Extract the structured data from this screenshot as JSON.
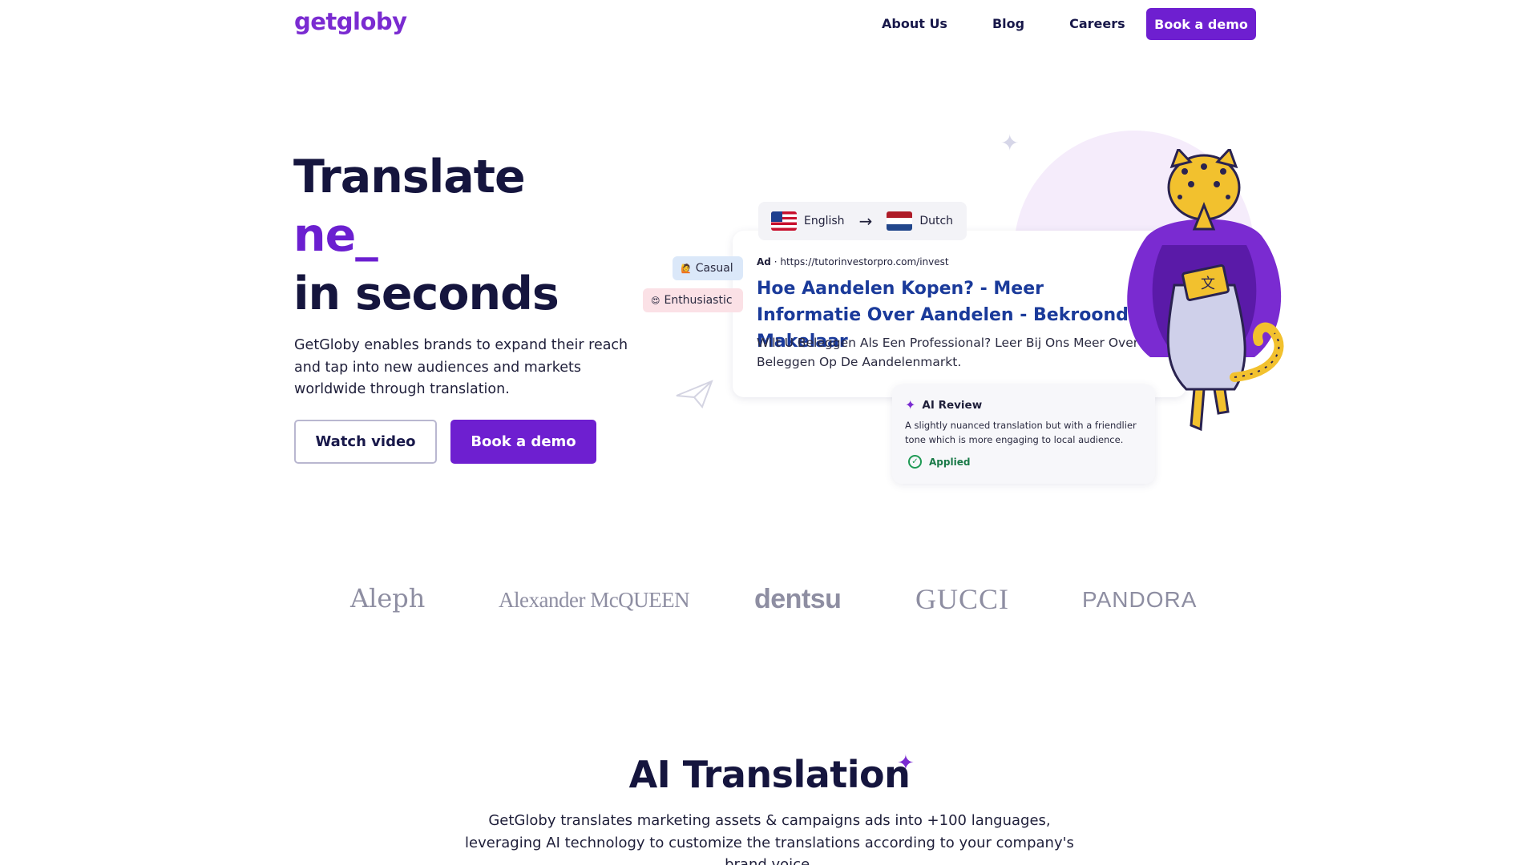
{
  "nav": {
    "logo": "getgloby",
    "links": [
      "About Us",
      "Blog",
      "Careers"
    ],
    "cta": "Book a demo"
  },
  "hero": {
    "title_line1": "Translate",
    "title_typed": "ne_",
    "title_line3": "in seconds",
    "description": "GetGloby enables brands to expand their reach and tap into new audiences and markets worldwide through translation.",
    "watch_video": "Watch video",
    "book_demo": "Book a demo"
  },
  "translation_demo": {
    "source_language": "English",
    "target_language": "Dutch",
    "tones": [
      {
        "emoji": "🙋",
        "label": "Casual"
      },
      {
        "emoji": "😍",
        "label": "Enthusiastic"
      }
    ],
    "ad": {
      "prefix": "Ad",
      "url": "· https://tutorinvestorpro.com/invest",
      "title": "Hoe Aandelen Kopen? - Meer Informatie Over Aandelen - Bekroonde Makelaar",
      "description": "Wilt U Beleggen Als Een Professional? Leer Bij Ons Meer Over Beleggen Op De Aandelenmarkt."
    },
    "review": {
      "title": "AI Review",
      "body": "A slightly nuanced translation but with a friendlier tone which is more engaging to local audience.",
      "status": "Applied"
    }
  },
  "brands": [
    "Aleph",
    "Alexander McQUEEN",
    "dentsu",
    "GUCCI",
    "PANDORA"
  ],
  "ai_section": {
    "title": "AI Translation",
    "description": "GetGloby translates marketing assets & campaigns ads into +100 languages, leveraging AI technology to customize the translations according to your company's brand voice."
  },
  "colors": {
    "brand_purple": "#6e1fd0",
    "navy": "#15153e",
    "ad_title_blue": "#1a3a9a",
    "applied_green": "#1f9a55"
  },
  "icons": [
    "us-flag-icon",
    "nl-flag-icon",
    "arrow-right-icon",
    "sparkle-icon",
    "check-circle-icon",
    "paper-plane-icon",
    "star-icon"
  ]
}
